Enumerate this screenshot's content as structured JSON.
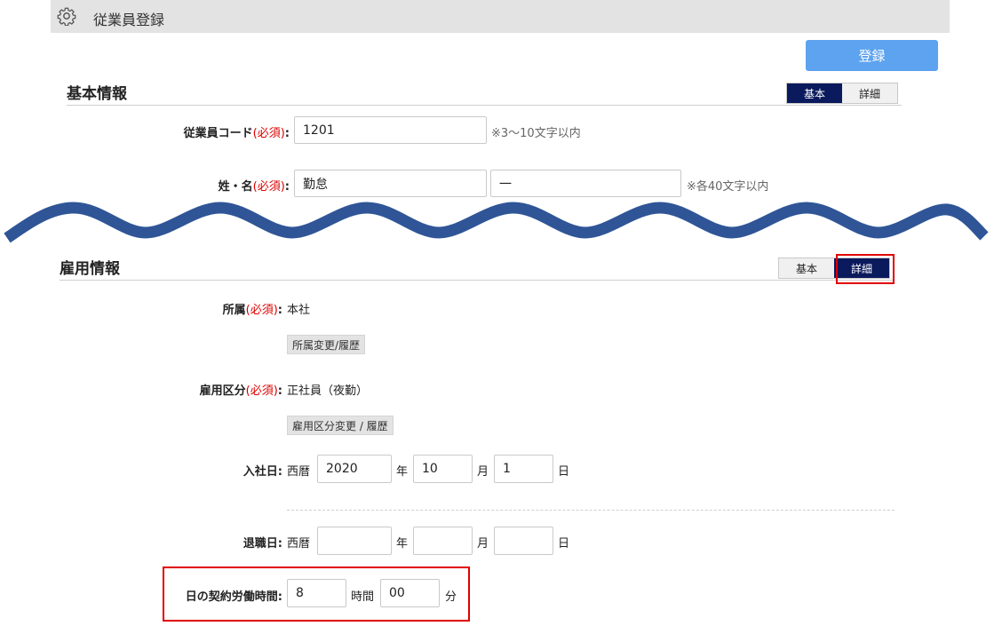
{
  "header": {
    "title": "従業員登録",
    "icon": "gear-icon"
  },
  "actions": {
    "register_label": "登録"
  },
  "basic_section": {
    "title": "基本情報",
    "toggle": {
      "basic": "基本",
      "detail": "詳細",
      "active": "basic"
    },
    "employee_code": {
      "label": "従業員コード",
      "required": "(必須)",
      "colon": ":",
      "value": "1201",
      "note": "※3～10文字以内"
    },
    "name": {
      "label": "姓・名",
      "required": "(必須)",
      "colon": ":",
      "last_name": "勤怠",
      "first_name": "一",
      "note": "※各40文字以内"
    }
  },
  "employment_section": {
    "title": "雇用情報",
    "toggle": {
      "basic": "基本",
      "detail": "詳細",
      "active": "detail"
    },
    "affiliation": {
      "label": "所属",
      "required": "(必須)",
      "colon": ":",
      "value": "本社",
      "button": "所属変更/履歴"
    },
    "employment_type": {
      "label": "雇用区分",
      "required": "(必須)",
      "colon": ":",
      "value": "正社員（夜勤）",
      "button": "雇用区分変更 / 履歴"
    },
    "hire_date": {
      "label": "入社日",
      "colon": ":",
      "era": "西暦",
      "year": "2020",
      "year_unit": "年",
      "month": "10",
      "month_unit": "月",
      "day": "1",
      "day_unit": "日"
    },
    "retire_date": {
      "label": "退職日",
      "colon": ":",
      "era": "西暦",
      "year": "",
      "year_unit": "年",
      "month": "",
      "month_unit": "月",
      "day": "",
      "day_unit": "日"
    },
    "contract_hours": {
      "label": "日の契約労働時間",
      "colon": ":",
      "hours": "8",
      "hours_unit": "時間",
      "minutes": "00",
      "minutes_unit": "分"
    }
  },
  "colors": {
    "accent": "#0a1a5c",
    "register_button": "#5da3f0",
    "required": "#dd0000",
    "highlight": "#e00000",
    "wave": "#2f5597"
  }
}
